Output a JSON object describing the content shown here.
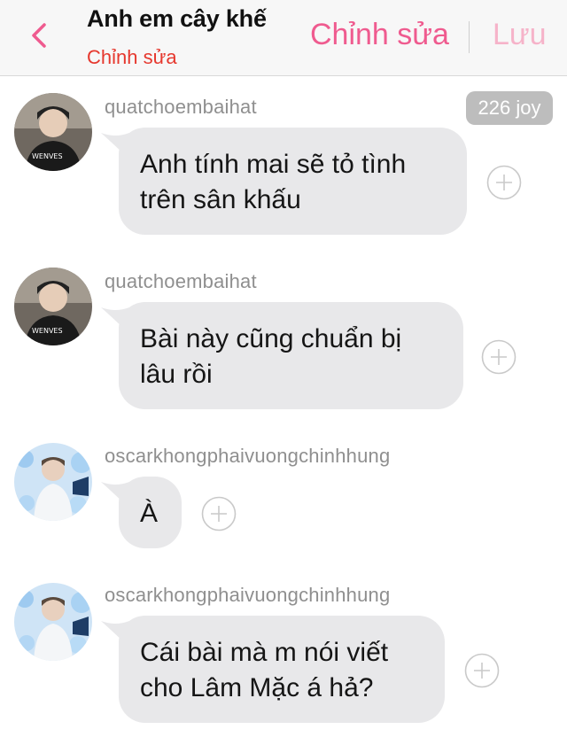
{
  "header": {
    "title": "Anh em cây khế",
    "subtitle": "Chỉnh sửa",
    "edit_label": "Chỉnh sửa",
    "save_label": "Lưu",
    "back_icon": "chevron-left-icon",
    "accent_color": "#ef5b8f",
    "subtitle_color": "#e6382e"
  },
  "messages": [
    {
      "username": "quatchoembaihat",
      "text_lines": [
        "Anh tính mai sẽ tỏ tình",
        "trên sân khấu"
      ],
      "badge": "226 joy",
      "avatar_icon": "user-avatar"
    },
    {
      "username": "quatchoembaihat",
      "text_lines": [
        "Bài này cũng chuẩn bị",
        "lâu rồi"
      ],
      "avatar_icon": "user-avatar"
    },
    {
      "username": "oscarkhongphaivuongchinhhung",
      "text_lines": [
        "À"
      ],
      "avatar_icon": "user-avatar"
    },
    {
      "username": "oscarkhongphaivuongchinhhung",
      "text_lines": [
        "Cái bài mà m nói viết",
        "cho Lâm Mặc á hả?"
      ],
      "avatar_icon": "user-avatar"
    }
  ],
  "colors": {
    "bubble": "#e8e8ea",
    "username": "#8f8f8f",
    "badge_bg": "#bdbdbd"
  }
}
